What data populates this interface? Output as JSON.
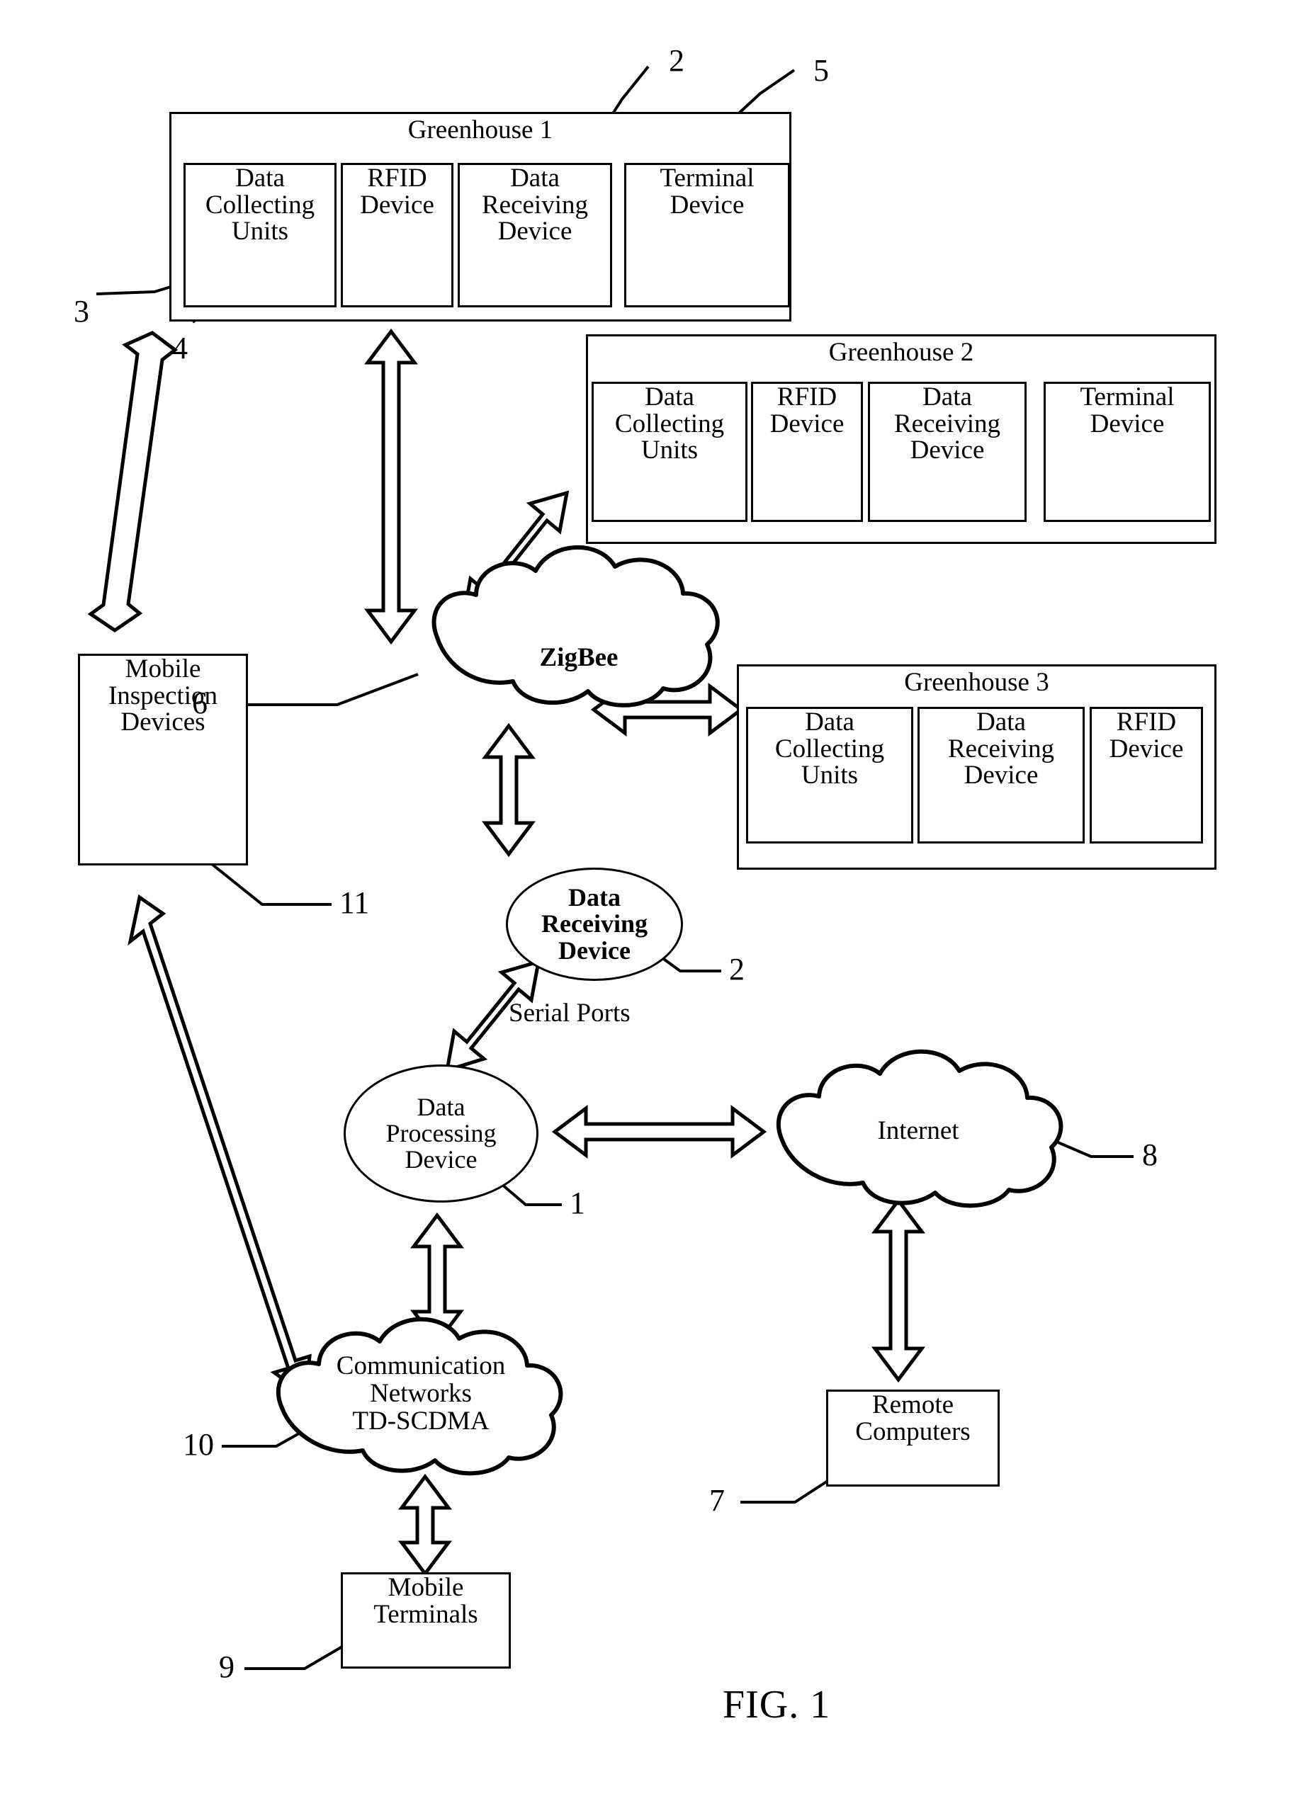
{
  "figure": {
    "caption": "FIG. 1",
    "greenhouses": [
      {
        "title": "Greenhouse 1",
        "ref_labels": [
          "3",
          "4",
          "2",
          "5"
        ],
        "units": [
          {
            "label": "Data\nCollecting\nUnits"
          },
          {
            "label": "RFID\nDevice"
          },
          {
            "label": "Data\nReceiving\nDevice"
          },
          {
            "label": "Terminal\nDevice"
          }
        ]
      },
      {
        "title": "Greenhouse 2",
        "units": [
          {
            "label": "Data\nCollecting\nUnits"
          },
          {
            "label": "RFID\nDevice"
          },
          {
            "label": "Data\nReceiving\nDevice"
          },
          {
            "label": "Terminal\nDevice"
          }
        ]
      },
      {
        "title": "Greenhouse 3",
        "units": [
          {
            "label": "Data\nCollecting\nUnits"
          },
          {
            "label": "Data\nReceiving\nDevice"
          },
          {
            "label": "RFID\nDevice"
          }
        ]
      }
    ],
    "nodes": {
      "zigbee": "ZigBee",
      "mobile_inspection_devices": "Mobile\nInspection\nDevices",
      "data_receiving_device": "Data\nReceiving\nDevice",
      "data_processing_device": "Data\nProcessing\nDevice",
      "internet": "Internet",
      "communication_networks": "Communication\nNetworks\nTD-SCDMA",
      "remote_computers": "Remote\nComputers",
      "mobile_terminals": "Mobile\nTerminals"
    },
    "labels": {
      "serial_ports": "Serial Ports"
    },
    "reference_numerals": {
      "n1": "1",
      "n2_top": "2",
      "n2_drd": "2",
      "n3": "3",
      "n4": "4",
      "n5": "5",
      "n6": "6",
      "n7": "7",
      "n8": "8",
      "n9": "9",
      "n10": "10",
      "n11": "11"
    },
    "colors": {
      "stroke": "#000000",
      "background": "#ffffff"
    }
  }
}
